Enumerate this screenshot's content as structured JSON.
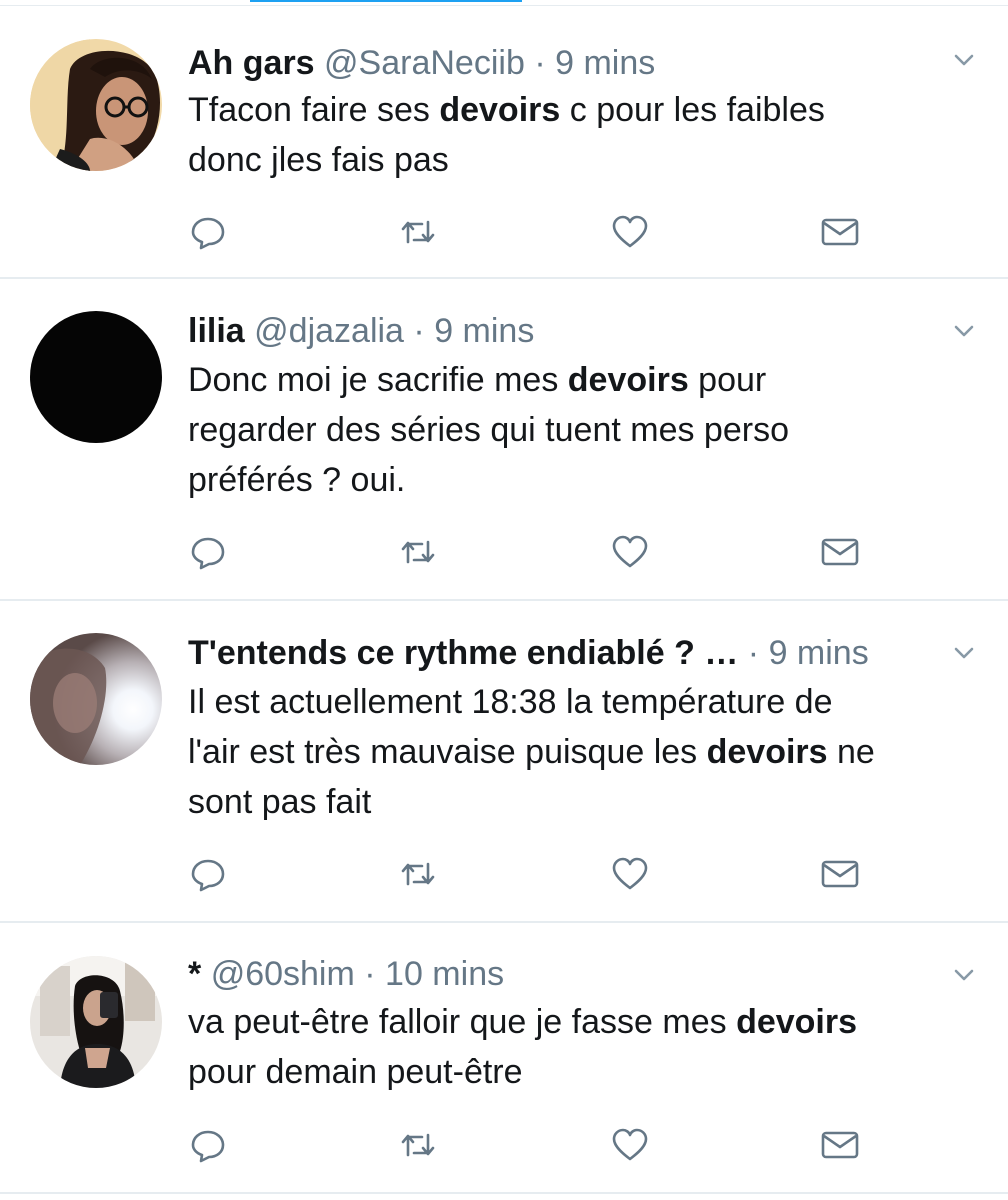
{
  "colors": {
    "text": "#14171a",
    "muted": "#657786",
    "divider": "#e6ecf0",
    "accent": "#1da1f2",
    "icon": "#657786"
  },
  "tweets": [
    {
      "name": "Ah gars",
      "handle": "@SaraNeciib",
      "separator": "·",
      "time": "9 mins",
      "text": [
        {
          "t": "Tfacon faire ses ",
          "b": false
        },
        {
          "t": "devoirs",
          "b": true
        },
        {
          "t": " c pour les faibles\ndonc jles fais pas",
          "b": false
        }
      ],
      "actions": [
        "reply-icon",
        "retweet-icon",
        "like-icon",
        "direct-message-icon"
      ]
    },
    {
      "name": "lilia",
      "handle": "@djazalia",
      "separator": "·",
      "time": "9 mins",
      "text": [
        {
          "t": "Donc moi je sacrifie mes ",
          "b": false
        },
        {
          "t": "devoirs",
          "b": true
        },
        {
          "t": " pour\nregarder des séries qui tuent mes perso\npréférés ? oui.",
          "b": false
        }
      ],
      "actions": [
        "reply-icon",
        "retweet-icon",
        "like-icon",
        "direct-message-icon"
      ]
    },
    {
      "name": "T'entends ce rythme endiablé ? …",
      "handle": "",
      "separator": "·",
      "time": "9 mins",
      "text": [
        {
          "t": "Il est actuellement 18:38 la température de\nl'air est très mauvaise puisque les ",
          "b": false
        },
        {
          "t": "devoirs",
          "b": true
        },
        {
          "t": " ne\nsont pas fait",
          "b": false
        }
      ],
      "actions": [
        "reply-icon",
        "retweet-icon",
        "like-icon",
        "direct-message-icon"
      ]
    },
    {
      "name": "*",
      "handle": "@60shim",
      "separator": "·",
      "time": "10 mins",
      "text": [
        {
          "t": "va peut-être falloir que je fasse mes ",
          "b": false
        },
        {
          "t": "devoirs",
          "b": true
        },
        {
          "t": "\npour demain peut-être",
          "b": false
        }
      ],
      "actions": [
        "reply-icon",
        "retweet-icon",
        "like-icon",
        "direct-message-icon"
      ]
    }
  ]
}
